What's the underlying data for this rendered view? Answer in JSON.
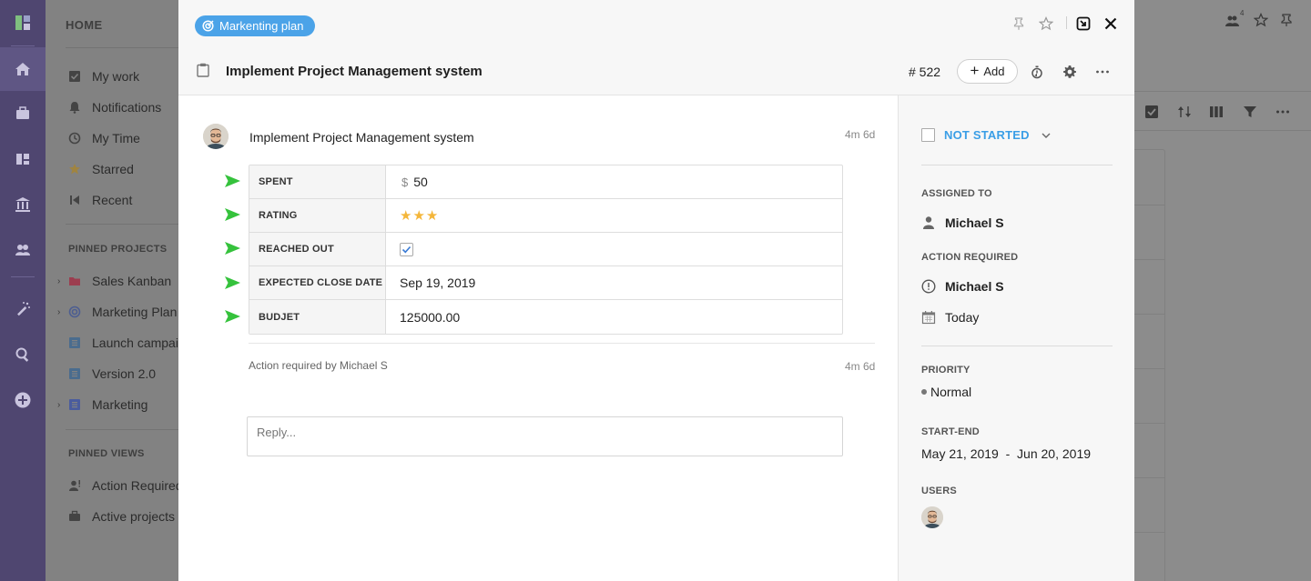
{
  "sidebar": {
    "heading": "HOME",
    "nav": [
      {
        "label": "My work",
        "icon": "checkbox-icon"
      },
      {
        "label": "Notifications",
        "icon": "bell-icon"
      },
      {
        "label": "My Time",
        "icon": "clock-icon"
      },
      {
        "label": "Starred",
        "icon": "star-icon"
      },
      {
        "label": "Recent",
        "icon": "recent-icon"
      }
    ],
    "pinned_projects_title": "PINNED PROJECTS",
    "pinned_projects": [
      {
        "label": "Sales Kanban",
        "icon": "folder-icon"
      },
      {
        "label": "Marketing Plan",
        "icon": "target-icon"
      },
      {
        "label": "Launch campaign",
        "icon": "list-icon"
      },
      {
        "label": "Version 2.0",
        "icon": "list-icon"
      },
      {
        "label": "Marketing",
        "icon": "list-icon"
      }
    ],
    "pinned_views_title": "PINNED VIEWS",
    "pinned_views": [
      {
        "label": "Action Required",
        "icon": "user-alert-icon"
      },
      {
        "label": "Active projects",
        "icon": "briefcase-icon"
      }
    ]
  },
  "task": {
    "project_chip": "Markenting plan",
    "title": "Implement Project Management system",
    "number": "# 522",
    "add_label": "Add"
  },
  "post": {
    "title": "Implement Project Management system",
    "timestamp": "4m 6d",
    "fields": [
      {
        "key": "SPENT",
        "currency": "$",
        "value": "50"
      },
      {
        "key": "RATING",
        "stars": 3,
        "star_glyphs": "★★★"
      },
      {
        "key": "REACHED OUT",
        "checked": true
      },
      {
        "key": "EXPECTED CLOSE DATE",
        "value": "Sep 19, 2019"
      },
      {
        "key": "BUDJET",
        "value": "125000.00"
      }
    ],
    "activity": "Action required by Michael S",
    "activity_timestamp": "4m 6d",
    "reply_placeholder": "Reply..."
  },
  "panel": {
    "status": "NOT STARTED",
    "assigned_to_label": "ASSIGNED TO",
    "assigned_to": "Michael S",
    "action_required_label": "ACTION REQUIRED",
    "action_required": "Michael S",
    "due": "Today",
    "priority_label": "PRIORITY",
    "priority": "Normal",
    "start_end_label": "START-END",
    "start_end": "May 21, 2019  -  Jun 20, 2019",
    "users_label": "USERS"
  },
  "colors": {
    "accent": "#4ba3e8",
    "status": "#3a9ee6",
    "star": "#f4b63a",
    "arrow": "#35c23c",
    "rail": "#4f4670"
  },
  "background_badge": "4"
}
